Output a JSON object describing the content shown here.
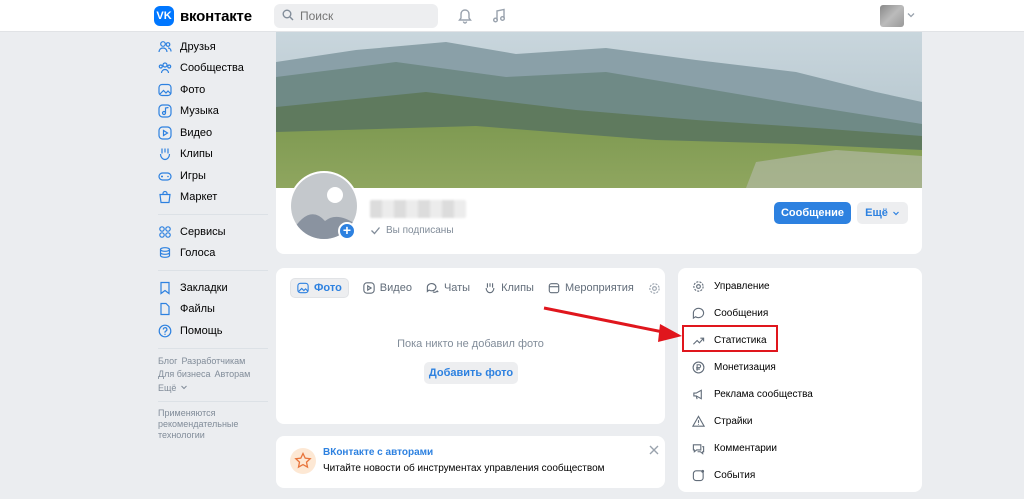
{
  "header": {
    "logo_mark": "VK",
    "logo_text": "вконтакте",
    "search_placeholder": "Поиск"
  },
  "leftnav": {
    "items": [
      {
        "label": "Друзья",
        "icon": "friends-icon"
      },
      {
        "label": "Сообщества",
        "icon": "communities-icon"
      },
      {
        "label": "Фото",
        "icon": "photo-icon"
      },
      {
        "label": "Музыка",
        "icon": "music-icon"
      },
      {
        "label": "Видео",
        "icon": "video-icon"
      },
      {
        "label": "Клипы",
        "icon": "clips-icon"
      },
      {
        "label": "Игры",
        "icon": "games-icon"
      },
      {
        "label": "Маркет",
        "icon": "market-icon"
      },
      {
        "label": "Сервисы",
        "icon": "services-icon"
      },
      {
        "label": "Голоса",
        "icon": "votes-icon"
      },
      {
        "label": "Закладки",
        "icon": "bookmarks-icon"
      },
      {
        "label": "Файлы",
        "icon": "files-icon"
      },
      {
        "label": "Помощь",
        "icon": "help-icon"
      }
    ],
    "footer": {
      "blog": "Блог",
      "developers": "Разработчикам",
      "business": "Для бизнеса",
      "authors": "Авторам",
      "more": "Ещё"
    },
    "reco": [
      "Применяются",
      "рекомендательные",
      "технологии"
    ]
  },
  "profile": {
    "subscribed": "Вы подписаны",
    "message_button": "Сообщение",
    "more_button": "Ещё"
  },
  "content": {
    "tabs": [
      {
        "label": "Фото",
        "active": true
      },
      {
        "label": "Видео",
        "active": false
      },
      {
        "label": "Чаты",
        "active": false
      },
      {
        "label": "Клипы",
        "active": false
      },
      {
        "label": "Мероприятия",
        "active": false
      }
    ],
    "empty_text": "Пока никто не добавил фото",
    "add_photo": "Добавить фото"
  },
  "promo": {
    "title": "ВКонтакте с авторами",
    "text": "Читайте новости об инструментах управления сообществом"
  },
  "rmenu": {
    "items": [
      {
        "label": "Управление",
        "icon": "gear-icon"
      },
      {
        "label": "Сообщения",
        "icon": "message-icon"
      },
      {
        "label": "Статистика",
        "icon": "stats-icon",
        "highlighted": true
      },
      {
        "label": "Монетизация",
        "icon": "ruble-icon"
      },
      {
        "label": "Реклама сообщества",
        "icon": "megaphone-icon"
      },
      {
        "label": "Страйки",
        "icon": "warning-icon"
      },
      {
        "label": "Комментарии",
        "icon": "comments-icon"
      },
      {
        "label": "События",
        "icon": "events-icon"
      }
    ]
  },
  "colors": {
    "accent": "#2d81e0",
    "highlight": "#e0161d",
    "background": "#ebedf0"
  }
}
